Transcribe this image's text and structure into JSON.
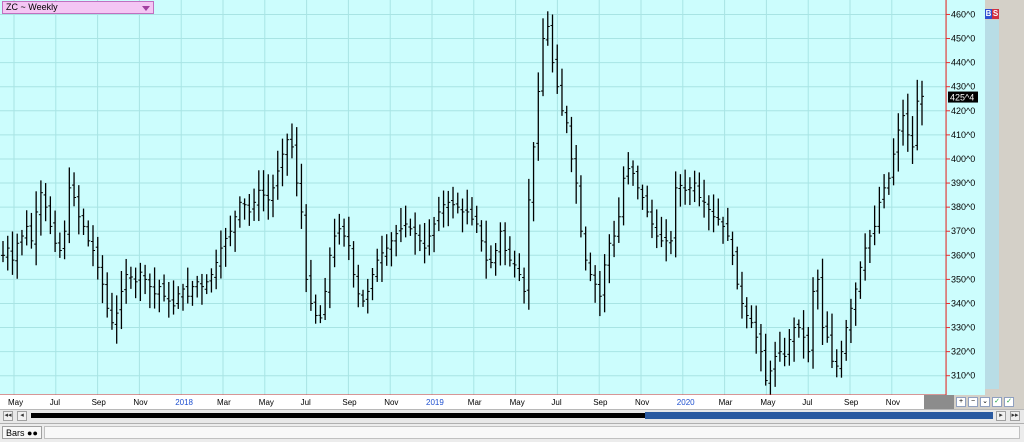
{
  "symbol_selector": {
    "label": "ZC ~ Weekly"
  },
  "buttons": {
    "buy": "B",
    "sell": "S"
  },
  "last_price_label": "425^4",
  "status_bar": {
    "tab_label": "Bars"
  },
  "colors": {
    "plot_bg": "#ccfdfd",
    "grid": "#a8e4e4",
    "bar": "#000000",
    "axis_line": "#e03030",
    "price_tag": "#000000"
  },
  "chart_data": {
    "type": "ohlc",
    "title": "ZC ~ Weekly",
    "y_ticks": [
      "310^0",
      "320^0",
      "330^0",
      "340^0",
      "350^0",
      "360^0",
      "370^0",
      "380^0",
      "390^0",
      "400^0",
      "410^0",
      "420^0",
      "430^0",
      "440^0",
      "450^0",
      "460^0"
    ],
    "y_range": [
      302,
      466
    ],
    "x_labels": [
      {
        "text": "May",
        "year": false
      },
      {
        "text": "Jul",
        "year": false
      },
      {
        "text": "Sep",
        "year": false
      },
      {
        "text": "Nov",
        "year": false
      },
      {
        "text": "2018",
        "year": true
      },
      {
        "text": "Mar",
        "year": false
      },
      {
        "text": "May",
        "year": false
      },
      {
        "text": "Jul",
        "year": false
      },
      {
        "text": "Sep",
        "year": false
      },
      {
        "text": "Nov",
        "year": false
      },
      {
        "text": "2019",
        "year": true
      },
      {
        "text": "Mar",
        "year": false
      },
      {
        "text": "May",
        "year": false
      },
      {
        "text": "Jul",
        "year": false
      },
      {
        "text": "Sep",
        "year": false
      },
      {
        "text": "Nov",
        "year": false
      },
      {
        "text": "2020",
        "year": true
      },
      {
        "text": "Mar",
        "year": false
      },
      {
        "text": "May",
        "year": false
      },
      {
        "text": "Jul",
        "year": false
      },
      {
        "text": "Sep",
        "year": false
      },
      {
        "text": "Nov",
        "year": false
      }
    ],
    "approx_weekly_closes": [
      360,
      363,
      358,
      365,
      368,
      372,
      366,
      378,
      386,
      380,
      372,
      365,
      362,
      370,
      388,
      384,
      376,
      372,
      366,
      362,
      355,
      348,
      338,
      332,
      336,
      345,
      352,
      351,
      349,
      353,
      350,
      347,
      344,
      347,
      343,
      341,
      339,
      344,
      346,
      343,
      347,
      349,
      347,
      349,
      352,
      357,
      363,
      367,
      370,
      376,
      382,
      381,
      378,
      382,
      387,
      385,
      383,
      388,
      395,
      402,
      408,
      405,
      390,
      378,
      350,
      340,
      335,
      334,
      345,
      360,
      368,
      371,
      368,
      364,
      352,
      344,
      341,
      345,
      352,
      358,
      361,
      363,
      366,
      369,
      371,
      373,
      371,
      369,
      366,
      363,
      368,
      373,
      378,
      381,
      382,
      381,
      380,
      378,
      378,
      375,
      373,
      366,
      358,
      357,
      362,
      370,
      362,
      358,
      356,
      352,
      345,
      383,
      405,
      428,
      450,
      455,
      440,
      430,
      420,
      415,
      400,
      390,
      370,
      358,
      352,
      348,
      343,
      356,
      365,
      368,
      376,
      392,
      396,
      394,
      388,
      384,
      378,
      373,
      368,
      366,
      366,
      366,
      388,
      389,
      387,
      388,
      390,
      384,
      382,
      379,
      376,
      375,
      372,
      368,
      360,
      348,
      340,
      335,
      332,
      326,
      320,
      308,
      312,
      318,
      320,
      318,
      325,
      330,
      330,
      326,
      320,
      345,
      350,
      330,
      326,
      316,
      314,
      320,
      330,
      338,
      346,
      355,
      363,
      368,
      372,
      382,
      388,
      392,
      402,
      412,
      418,
      410,
      405,
      424,
      426
    ]
  }
}
